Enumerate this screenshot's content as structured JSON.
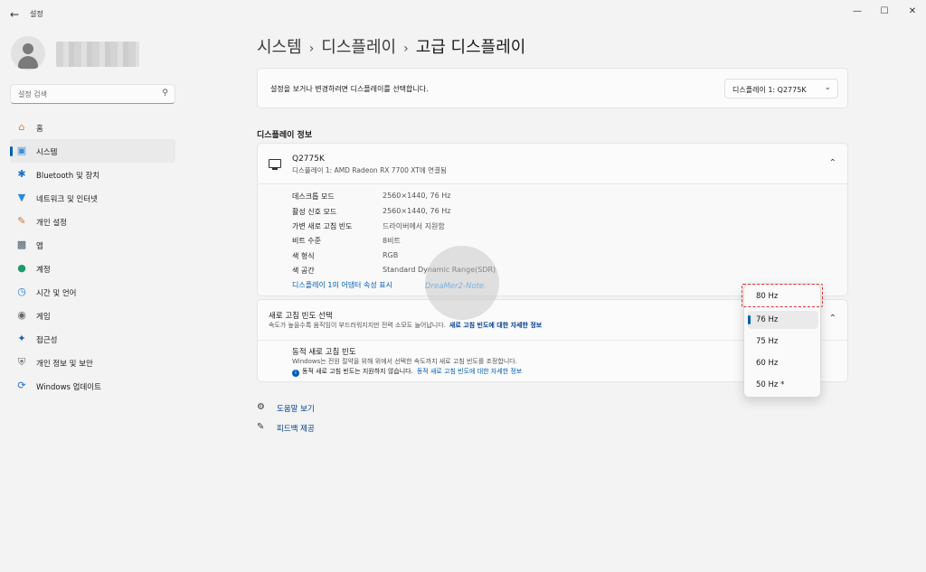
{
  "window": {
    "title": "설정"
  },
  "sidebar": {
    "search_placeholder": "설정 검색",
    "items": [
      {
        "label": "홈",
        "icon": "home-icon"
      },
      {
        "label": "시스템",
        "icon": "system-icon",
        "active": true
      },
      {
        "label": "Bluetooth 및 장치",
        "icon": "bluetooth-icon"
      },
      {
        "label": "네트워크 및 인터넷",
        "icon": "network-icon"
      },
      {
        "label": "개인 설정",
        "icon": "brush-icon"
      },
      {
        "label": "앱",
        "icon": "apps-icon"
      },
      {
        "label": "계정",
        "icon": "account-icon"
      },
      {
        "label": "시간 및 언어",
        "icon": "time-language-icon"
      },
      {
        "label": "게임",
        "icon": "gamepad-icon"
      },
      {
        "label": "접근성",
        "icon": "accessibility-icon"
      },
      {
        "label": "개인 정보 및 보안",
        "icon": "shield-icon"
      },
      {
        "label": "Windows 업데이트",
        "icon": "update-icon"
      }
    ]
  },
  "breadcrumb": {
    "level1": "시스템",
    "level2": "디스플레이",
    "current": "고급 디스플레이"
  },
  "display_select": {
    "message": "설정을 보거나 변경하려면 디스플레이를 선택합니다.",
    "value": "디스플레이 1: Q2775K"
  },
  "display_info": {
    "section_title": "디스플레이 정보",
    "monitor_name": "Q2775K",
    "monitor_sub": "디스플레이 1: AMD Radeon RX 7700 XT에 연결됨",
    "rows": [
      {
        "key": "데스크톱 모드",
        "value": "2560×1440, 76 Hz"
      },
      {
        "key": "활성 신호 모드",
        "value": "2560×1440, 76 Hz"
      },
      {
        "key": "가변 새로 고침 빈도",
        "value": "드라이버에서 지원함"
      },
      {
        "key": "비트 수준",
        "value": "8비트"
      },
      {
        "key": "색 형식",
        "value": "RGB"
      },
      {
        "key": "색 공간",
        "value": "Standard Dynamic Range(SDR)"
      }
    ],
    "adapter_link": "디스플레이 1의 어댑터 속성 표시"
  },
  "watermark": "DreaMer2-Note.",
  "refresh": {
    "title": "새로 고침 빈도 선택",
    "desc": "속도가 높을수록 움직임이 부드러워지지만 전력 소모도 늘어납니다.",
    "link": "새로 고침 빈도에 대한 자세한 정보",
    "dynamic_title": "동적 새로 고침 빈도",
    "dynamic_desc": "Windows는 전원 절약을 위해 위에서 선택한 속도까지 새로 고침 빈도를 조정합니다.",
    "dynamic_note": "동적 새로 고침 빈도는 지원하지 않습니다.",
    "dynamic_link": "동적 새로 고침 빈도에 대한 자세한 정보"
  },
  "dropdown": {
    "options": [
      "80 Hz",
      "76 Hz",
      "75 Hz",
      "60 Hz",
      "50 Hz *"
    ],
    "selected": "76 Hz",
    "highlighted": "80 Hz"
  },
  "footer": {
    "help": "도움말 보기",
    "feedback": "피드백 제공"
  },
  "colors": {
    "accent": "#005fb8",
    "highlight": "#d9343a"
  }
}
